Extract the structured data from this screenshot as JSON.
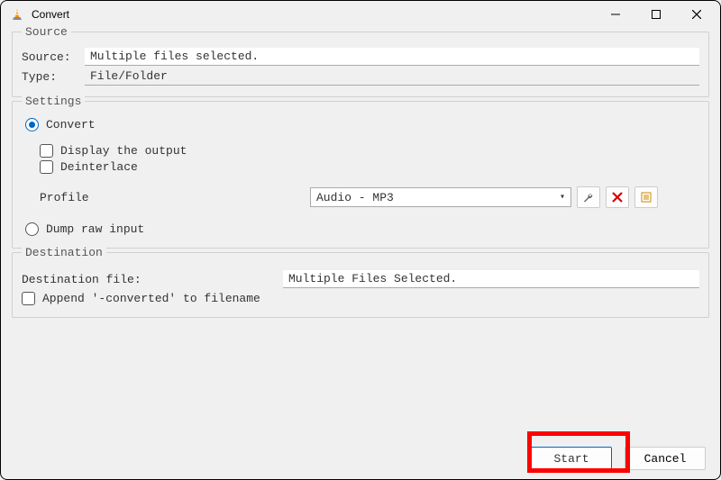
{
  "window": {
    "title": "Convert"
  },
  "source": {
    "group_label": "Source",
    "source_label": "Source:",
    "source_value": "Multiple files selected.",
    "type_label": "Type:",
    "type_value": "File/Folder"
  },
  "settings": {
    "group_label": "Settings",
    "convert_label": "Convert",
    "display_output_label": "Display the output",
    "deinterlace_label": "Deinterlace",
    "profile_label": "Profile",
    "profile_value": "Audio - MP3",
    "dump_label": "Dump raw input"
  },
  "destination": {
    "group_label": "Destination",
    "dest_file_label": "Destination file:",
    "dest_file_value": "Multiple Files Selected.",
    "append_label": "Append '-converted' to filename"
  },
  "footer": {
    "start_label": "Start",
    "cancel_label": "Cancel"
  }
}
